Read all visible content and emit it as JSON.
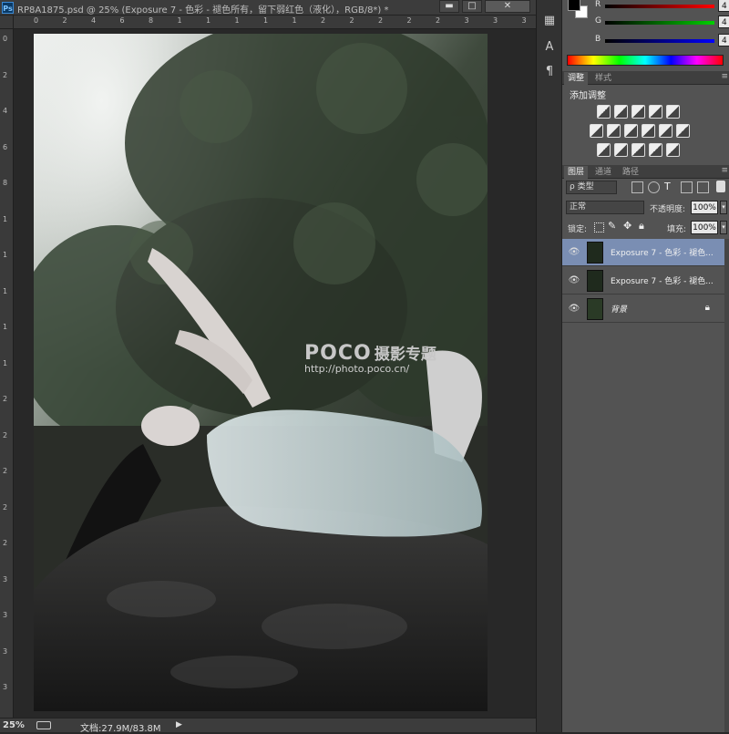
{
  "document": {
    "title": "RP8A1875.psd @ 25% (Exposure 7 - 色彩 - 褪色所有，留下弱红色（液化），RGB/8*) *",
    "app_icon": "Ps",
    "controls": {
      "minimize": "▬",
      "restore": "□",
      "close": "✕"
    },
    "ruler_top": [
      "0",
      "2",
      "4",
      "6",
      "8",
      "1",
      "1",
      "1",
      "1",
      "1",
      "2",
      "2",
      "2",
      "2",
      "2",
      "3",
      "3",
      "3",
      "3",
      "3"
    ],
    "ruler_left": [
      "0",
      "2",
      "4",
      "6",
      "8",
      "1",
      "1",
      "1",
      "1",
      "1",
      "2",
      "2",
      "2",
      "2",
      "2",
      "3",
      "3",
      "3",
      "3"
    ],
    "watermark": {
      "brand": "POCO",
      "tagline": "摄影专题",
      "url": "http://photo.poco.cn/"
    },
    "zoom": "25%",
    "doc_info": "文档:27.9M/83.8M",
    "status_arrow": "▶"
  },
  "color_panel": {
    "channels": [
      {
        "label": "R",
        "value": "4",
        "color": "#ff0000"
      },
      {
        "label": "G",
        "value": "4",
        "color": "#00d000"
      },
      {
        "label": "B",
        "value": "4",
        "color": "#0000ff"
      }
    ]
  },
  "adjustments": {
    "tabs": [
      "调整",
      "样式"
    ],
    "title": "添加调整",
    "icon_rows": [
      [
        "brightness-icon",
        "levels-icon",
        "curves-icon",
        "exposure-icon",
        "vibrance-icon"
      ],
      [
        "hue-saturation-icon",
        "color-balance-icon",
        "black-white-icon",
        "photo-filter-icon",
        "channel-mixer-icon",
        "color-lookup-icon"
      ],
      [
        "invert-icon",
        "posterize-icon",
        "threshold-icon",
        "gradient-map-icon",
        "selective-color-icon"
      ]
    ]
  },
  "layers": {
    "tabs": [
      "图层",
      "通道",
      "路径"
    ],
    "filter_kind": "ρ 类型",
    "blend_mode": "正常",
    "opacity_label": "不透明度:",
    "opacity": "100%",
    "lock_label": "锁定:",
    "fill_label": "填充:",
    "fill": "100%",
    "items": [
      {
        "name": "Exposure 7 - 色彩 - 褪色...",
        "selected": true,
        "locked": false
      },
      {
        "name": "Exposure 7 - 色彩 - 褪色...",
        "selected": false,
        "locked": false
      },
      {
        "name": "背景",
        "selected": false,
        "locked": true
      }
    ]
  }
}
